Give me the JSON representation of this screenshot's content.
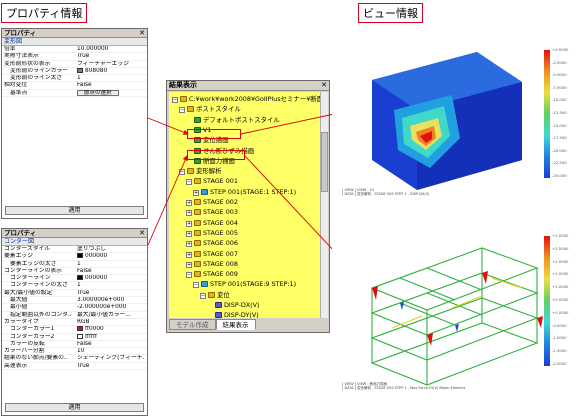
{
  "callouts": {
    "property": "プロパティ情報",
    "view": "ビュー情報"
  },
  "panel_top": {
    "title": "プロパティ",
    "subtitle": "変形図",
    "rows": [
      {
        "k": "倍率",
        "v": "10.000000"
      },
      {
        "k": "実際寸法表示",
        "v": "True"
      },
      {
        "k": "変形前形状の表示",
        "v": "フィーチャーエッジ"
      },
      {
        "k": "変形前のラインカラー",
        "v": "808080",
        "swatch": "#808080",
        "indent": true
      },
      {
        "k": "変形前のライン太さ",
        "v": "1",
        "indent": true
      },
      {
        "k": "相対変位",
        "v": "False"
      },
      {
        "k": "基準点",
        "v": "",
        "button": "節点の選択",
        "indent": true
      }
    ],
    "apply": "適用"
  },
  "panel_bottom": {
    "title": "プロパティ",
    "subtitle": "コンター図",
    "rows": [
      {
        "k": "コンタースタイル",
        "v": "塗りつぶし"
      },
      {
        "k": "要素エッジ",
        "v": "000000",
        "swatch": "#000000"
      },
      {
        "k": "要素エッジの太さ",
        "v": "1",
        "indent": true
      },
      {
        "k": "コンターラインの表示",
        "v": "False"
      },
      {
        "k": "コンターライン",
        "v": "000000",
        "swatch": "#000000",
        "indent": true
      },
      {
        "k": "コンターラインの太さ",
        "v": "1",
        "indent": true
      },
      {
        "k": "最大/最小値の設定",
        "v": "True"
      },
      {
        "k": "最大値",
        "v": "3.000000e+000",
        "indent": true
      },
      {
        "k": "最小値",
        "v": "-2.000000e+000",
        "indent": true
      },
      {
        "k": "指定範囲以外のコンタ..",
        "v": "最大/最小値カラー...",
        "indent": true
      },
      {
        "k": "カラータイプ",
        "v": "RGB"
      },
      {
        "k": "コンターカラー1",
        "v": "ff0000",
        "swatch": "#ff0000",
        "indent": true
      },
      {
        "k": "コンターカラー2",
        "v": "ffffff",
        "swatch": "#ffffff",
        "indent": true
      },
      {
        "k": "カラーの反転",
        "v": "False",
        "indent": true
      },
      {
        "k": "カラーバー分割",
        "v": "10"
      },
      {
        "k": "結果のない節点/要素の..",
        "v": "シェーディング(フィーチ..."
      },
      {
        "k": "高速表示",
        "v": "True"
      }
    ],
    "apply": "適用"
  },
  "tree_panel": {
    "title": "結果表示",
    "nodes": [
      {
        "text": "C:¥work¥work2008¥GoIIPlusセミナー¥断面解",
        "depth": 0,
        "icon": "folder",
        "exp": "-"
      },
      {
        "text": "ポストスタイル",
        "depth": 1,
        "icon": "folder",
        "exp": "-"
      },
      {
        "text": "デフォルトポストスタイル",
        "depth": 2,
        "icon": "style",
        "exp": ""
      },
      {
        "text": "V1",
        "depth": 2,
        "icon": "style",
        "exp": ""
      },
      {
        "text": "変位描画",
        "depth": 2,
        "icon": "style",
        "exp": ""
      },
      {
        "text": "せん断ひずみ描画",
        "depth": 2,
        "icon": "style",
        "exp": ""
      },
      {
        "text": "断面力描画",
        "depth": 2,
        "icon": "style",
        "exp": ""
      },
      {
        "text": "変形解析",
        "depth": 1,
        "icon": "folder",
        "exp": "-"
      },
      {
        "text": "STAGE 001",
        "depth": 2,
        "icon": "folder",
        "exp": "-"
      },
      {
        "text": "STEP 001(STAGE:1 STEP:1)",
        "depth": 3,
        "icon": "step",
        "exp": "+"
      },
      {
        "text": "STAGE 002",
        "depth": 2,
        "icon": "folder",
        "exp": "+"
      },
      {
        "text": "STAGE 003",
        "depth": 2,
        "icon": "folder",
        "exp": "+"
      },
      {
        "text": "STAGE 004",
        "depth": 2,
        "icon": "folder",
        "exp": "+"
      },
      {
        "text": "STAGE 005",
        "depth": 2,
        "icon": "folder",
        "exp": "+"
      },
      {
        "text": "STAGE 006",
        "depth": 2,
        "icon": "folder",
        "exp": "+"
      },
      {
        "text": "STAGE 007",
        "depth": 2,
        "icon": "folder",
        "exp": "+"
      },
      {
        "text": "STAGE 008",
        "depth": 2,
        "icon": "folder",
        "exp": "+"
      },
      {
        "text": "STAGE 009",
        "depth": 2,
        "icon": "folder",
        "exp": "-"
      },
      {
        "text": "STEP 001(STAGE:9 STEP:1)",
        "depth": 3,
        "icon": "step",
        "exp": "-"
      },
      {
        "text": "変位",
        "depth": 4,
        "icon": "folder",
        "exp": "-"
      },
      {
        "text": "DISP-DX(V)",
        "depth": 5,
        "icon": "disp",
        "exp": ""
      },
      {
        "text": "DISP-DY(V)",
        "depth": 5,
        "icon": "disp",
        "exp": ""
      }
    ],
    "tabs": [
      "モデル作成",
      "結果表示"
    ]
  },
  "views": {
    "top_caption": [
      "[ VIEW ] VIEW : V1",
      "[ DATA ] 変形解析 , STAGE 009 STEP 1 , DISP-DX(V)"
    ],
    "top_legend": [
      "+0.0000",
      "-2.5000",
      "-5.0000",
      "-7.5000",
      "-10.000",
      "-12.500",
      "-15.000",
      "-17.500",
      "-20.000",
      "-22.500",
      "-25.000"
    ],
    "bottom_caption": [
      "[ VIEW ] VIEW : 断面力描画",
      "[ DATA ] 変形解析 , STAGE 009 STEP 1 , Max Force-Fx(V) Beam Element"
    ],
    "bottom_legend": [
      "+3.0000",
      "+2.5000",
      "+2.0000",
      "+1.5000",
      "+1.0000",
      "+0.5000",
      "+0.0000",
      "-0.5000",
      "-1.0000",
      "-1.5000",
      "-2.0000"
    ]
  }
}
